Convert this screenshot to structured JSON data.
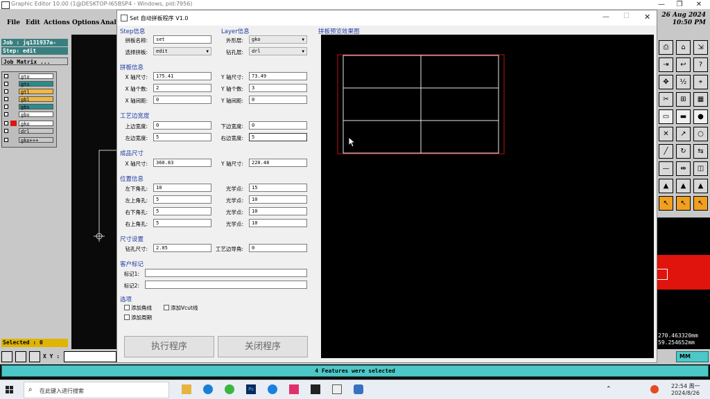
{
  "app": {
    "title": "Graphic Editor 10.00 (1@DESKTOP-I65BSP4 - Windows, pid:7956)",
    "menu": [
      "File",
      "Edit",
      "Actions",
      "Options",
      "Analy"
    ],
    "job_label": "Job : jq131937a-",
    "step_label": "Step: edit",
    "job_matrix_button": "Job Matrix ...",
    "layers": [
      {
        "name": "gto",
        "color": "#ffffff"
      },
      {
        "name": "gts",
        "color": "#2e8b8b"
      },
      {
        "name": "gtl",
        "color": "#f0b840"
      },
      {
        "name": "gbl",
        "color": "#f0b840"
      },
      {
        "name": "gbs",
        "color": "#2e8b8b"
      },
      {
        "name": "gbo",
        "color": "#ffffff"
      },
      {
        "name": "gko",
        "color": "#ffffff"
      },
      {
        "name": "drl",
        "color": "#c8c8c8"
      },
      {
        "name": "gko+++",
        "color": "#c8c8c8"
      }
    ],
    "date": "26 Aug 2024",
    "time": "10:50 PM",
    "coord_x": "270.463320mm",
    "coord_y": "59.254652mm",
    "selected": "Selected : 0",
    "xy_label": "X Y :",
    "units": "MM",
    "status": "4 Features were selected"
  },
  "dialog": {
    "title": "Set 自动拼板程序  V1.0",
    "step_group": "Step信息",
    "layer_group": "Layer信息",
    "panel_name_label": "拼板名称:",
    "panel_name_value": "set",
    "select_panel_label": "选择拼板:",
    "select_panel_value": "edit",
    "outline_layer_label": "外形层:",
    "outline_layer_value": "gko",
    "drill_layer_label": "钻孔层:",
    "drill_layer_value": "drl",
    "panel_group": "拼板信息",
    "x_size_label": "X 轴尺寸:",
    "x_size_value": "175.41",
    "y_size_label": "Y 轴尺寸:",
    "y_size_value": "73.49",
    "x_count_label": "X 轴个数:",
    "x_count_value": "2",
    "y_count_label": "Y 轴个数:",
    "y_count_value": "3",
    "x_gap_label": "X 轴间距:",
    "x_gap_value": "0",
    "y_gap_label": "Y 轴间距:",
    "y_gap_value": "0",
    "edge_group": "工艺边宽度",
    "top_edge_label": "上边宽度:",
    "top_edge_value": "0",
    "bottom_edge_label": "下边宽度:",
    "bottom_edge_value": "0",
    "left_edge_label": "左边宽度:",
    "left_edge_value": "5",
    "right_edge_label": "右边宽度:",
    "right_edge_value": "5",
    "finish_group": "成品尺寸",
    "fx_label": "X 轴尺寸:",
    "fx_value": "360.83",
    "fy_label": "Y 轴尺寸:",
    "fy_value": "220.48",
    "pos_group": "位置信息",
    "pos_rows": [
      {
        "hole_label": "左下角孔:",
        "hole_value": "10",
        "opt_label": "光学点:",
        "opt_value": "15"
      },
      {
        "hole_label": "左上角孔:",
        "hole_value": "5",
        "opt_label": "光学点:",
        "opt_value": "10"
      },
      {
        "hole_label": "右下角孔:",
        "hole_value": "5",
        "opt_label": "光学点:",
        "opt_value": "10"
      },
      {
        "hole_label": "右上角孔:",
        "hole_value": "5",
        "opt_label": "光学点:",
        "opt_value": "10"
      }
    ],
    "size_group": "尺寸设置",
    "drill_size_label": "钻孔尺寸:",
    "drill_size_value": "2.05",
    "edge_type_label": "工艺边导角:",
    "edge_type_value": "0",
    "customer_group": "客户标记",
    "mark1_label": "标记1:",
    "mark2_label": "标记2:",
    "option_group": "选项",
    "opt_corner": "添加角线",
    "opt_vcut": "添加Vcut线",
    "opt_period": "添加周期",
    "run_button": "执行程序",
    "close_button": "关闭程序",
    "preview_label": "拼板预览效果图",
    "preview_grid": {
      "cols": 2,
      "rows": 3
    }
  },
  "taskbar": {
    "search_placeholder": "在此键入进行搜索",
    "time": "22:54 周一",
    "date": "2024/8/26"
  }
}
